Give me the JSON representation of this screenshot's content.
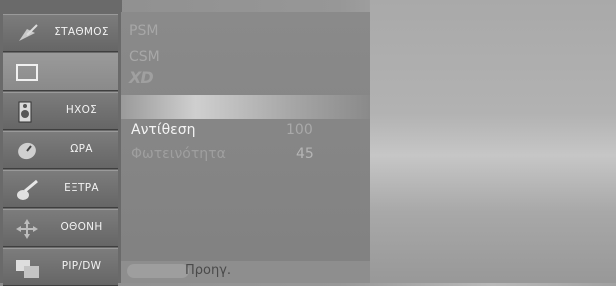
{
  "sidebar": {
    "items": [
      {
        "label": "ΣΤΑΘΜΟΣ",
        "icon": "satellite-dish-icon"
      },
      {
        "label": "",
        "icon": "screen-frame-icon"
      },
      {
        "label": "ΗΧΟΣ",
        "icon": "speaker-icon"
      },
      {
        "label": "ΩΡΑ",
        "icon": "clock-icon"
      },
      {
        "label": "ΕΞΤΡΑ",
        "icon": "guitar-icon"
      },
      {
        "label": "ΟΘΟΝΗ",
        "icon": "arrows-move-icon"
      },
      {
        "label": "PIP/DW",
        "icon": "pip-windows-icon"
      }
    ]
  },
  "panel": {
    "titles": [
      "PSM",
      "CSM"
    ],
    "logo": "XD",
    "rows": [
      {
        "label": "Αντίθεση",
        "value": "100"
      },
      {
        "label": "Φωτεινότητα",
        "value": "45"
      }
    ],
    "bottom_label": "Προηγ."
  }
}
